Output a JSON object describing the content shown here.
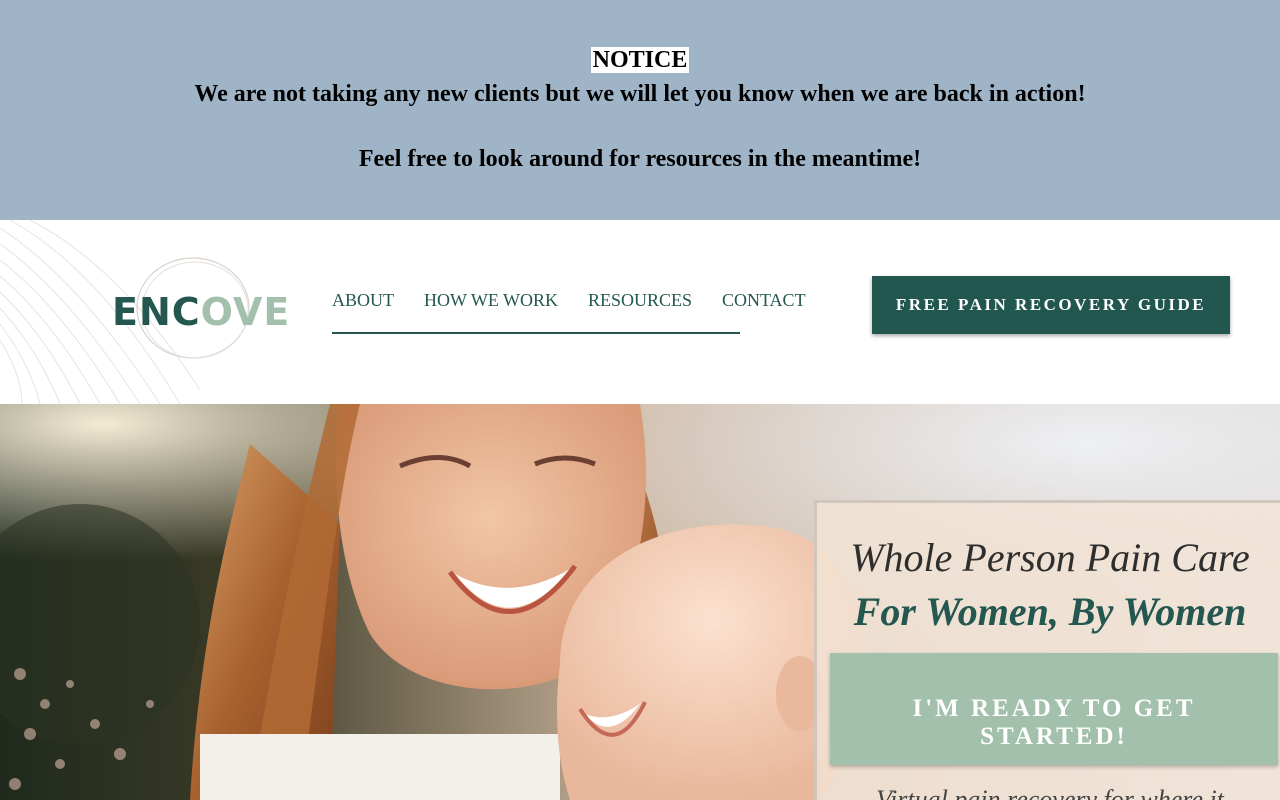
{
  "notice": {
    "title": "NOTICE",
    "line1": "We are not taking any new clients but we will let you know when we are back in action!",
    "line2": "Feel free to look around for resources in the meantime!"
  },
  "header": {
    "logo_part1": "ENC",
    "logo_part2": "OVE",
    "nav": {
      "about": "ABOUT",
      "how_we_work": "HOW WE WORK",
      "resources": "RESOURCES",
      "contact": "CONTACT"
    },
    "cta_label": "FREE PAIN RECOVERY GUIDE"
  },
  "hero": {
    "title": "Whole Person Pain Care",
    "subtitle": "For Women, By Women",
    "cta_label": "I'M READY TO GET STARTED!",
    "tagline": "Virtual pain recovery for where it"
  },
  "colors": {
    "notice_bg": "#a0b4c7",
    "brand_dark_green": "#22574f",
    "brand_sage": "#a3c0ad"
  }
}
